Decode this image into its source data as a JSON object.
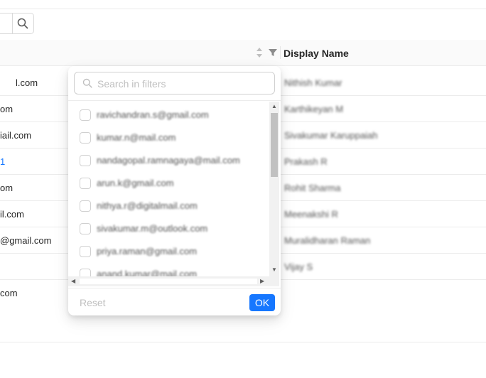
{
  "toolbar": {
    "search_icon": "search-icon"
  },
  "table": {
    "display_name_header": "Display Name",
    "sort_icon": "sorter-icon",
    "filter_icon": "filter-icon",
    "rows": [
      {
        "left": "l.com",
        "right": "Nithish Kumar"
      },
      {
        "left": "om",
        "right": "Karthikeyan M"
      },
      {
        "left": "iail.com",
        "right": "Sivakumar Karuppaiah"
      },
      {
        "left": "1",
        "right": "Prakash R"
      },
      {
        "left": "om",
        "right": "Rohit Sharma"
      },
      {
        "left": "il.com",
        "right": "Meenakshi R"
      },
      {
        "left": "@gmail.com",
        "right": "Muralidharan Raman"
      },
      {
        "left": "",
        "right": "Vijay S"
      },
      {
        "left": "com",
        "right": ""
      }
    ]
  },
  "filter_dropdown": {
    "search_placeholder": "Search in filters",
    "items": [
      "ravichandran.s@gmail.com",
      "kumar.n@mail.com",
      "nandagopal.ramnagaya@mail.com",
      "arun.k@gmail.com",
      "nithya.r@digitalmail.com",
      "sivakumar.m@outlook.com",
      "priya.raman@gmail.com",
      "anand.kumar@mail.com"
    ],
    "reset_label": "Reset",
    "ok_label": "OK"
  },
  "colors": {
    "primary": "#1677ff",
    "border": "#d9d9d9",
    "header_bg": "#fafafa"
  }
}
